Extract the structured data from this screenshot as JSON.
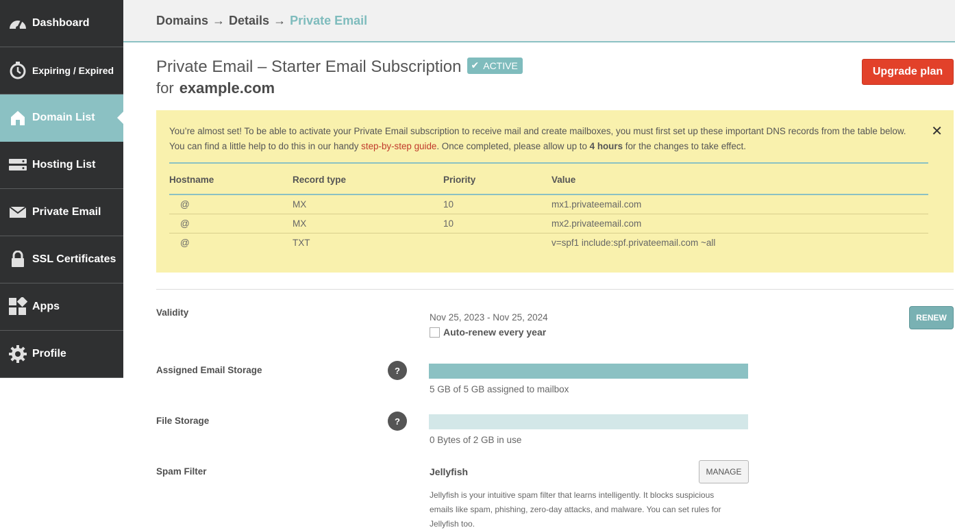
{
  "sidebar": {
    "items": [
      {
        "label": "Dashboard",
        "icon": "gauge-icon"
      },
      {
        "label": "Expiring / Expired",
        "icon": "stopwatch-icon"
      },
      {
        "label": "Domain List",
        "icon": "home-icon",
        "active": true
      },
      {
        "label": "Hosting List",
        "icon": "server-icon"
      },
      {
        "label": "Private Email",
        "icon": "envelope-icon"
      },
      {
        "label": "SSL Certificates",
        "icon": "lock-icon"
      },
      {
        "label": "Apps",
        "icon": "apps-grid-icon"
      },
      {
        "label": "Profile",
        "icon": "gear-icon"
      }
    ]
  },
  "breadcrumb": {
    "items": [
      "Domains",
      "Details",
      "Private Email"
    ],
    "separator": "→"
  },
  "header": {
    "title": "Private Email – Starter Email Subscription",
    "status": "ACTIVE",
    "for_prefix": "for",
    "domain": "example.com",
    "upgrade_label": "Upgrade plan"
  },
  "notice": {
    "text_before_link": "You’re almost set! To be able to activate your Private Email subscription to receive mail and create mailboxes, you must first set up these important DNS records from the table below. You can find a little help to do this in our handy ",
    "link_text": "step-by-step guide",
    "text_after_link": ". Once completed, please allow up to ",
    "bold_text": "4 hours",
    "text_end": " for the changes to take effect.",
    "close_symbol": "✕",
    "table": {
      "headers": [
        "Hostname",
        "Record type",
        "Priority",
        "Value"
      ],
      "rows": [
        [
          "@",
          "MX",
          "10",
          "mx1.privateemail.com"
        ],
        [
          "@",
          "MX",
          "10",
          "mx2.privateemail.com"
        ],
        [
          "@",
          "TXT",
          "",
          "v=spf1 include:spf.privateemail.com ~all"
        ]
      ]
    }
  },
  "details": {
    "validity_label": "Validity",
    "validity_value": "Nov 25, 2023 - Nov 25, 2024",
    "auto_renew_label": "Auto-renew every year",
    "renew_label": "RENEW",
    "email_storage_label": "Assigned Email Storage",
    "email_storage_value": "5 GB of 5 GB assigned to mailbox",
    "email_storage_fraction": 1.0,
    "file_storage_label": "File Storage",
    "file_storage_value": "0 Bytes of 2 GB in use",
    "file_storage_fraction": 0.0,
    "help_symbol": "?",
    "spam_label": "Spam Filter",
    "spam_name": "Jellyfish",
    "manage_label": "MANAGE",
    "spam_description": "Jellyfish is your intuitive spam filter that learns intelligently. It blocks suspicious emails like spam, phishing, zero-day attacks, and malware. You can set rules for Jellyfish too."
  },
  "colors": {
    "sidebar_bg": "#2f3031",
    "accent_teal": "#8bc1c3",
    "upgrade_red": "#e2412a",
    "notice_yellow": "#f9f1ad"
  }
}
